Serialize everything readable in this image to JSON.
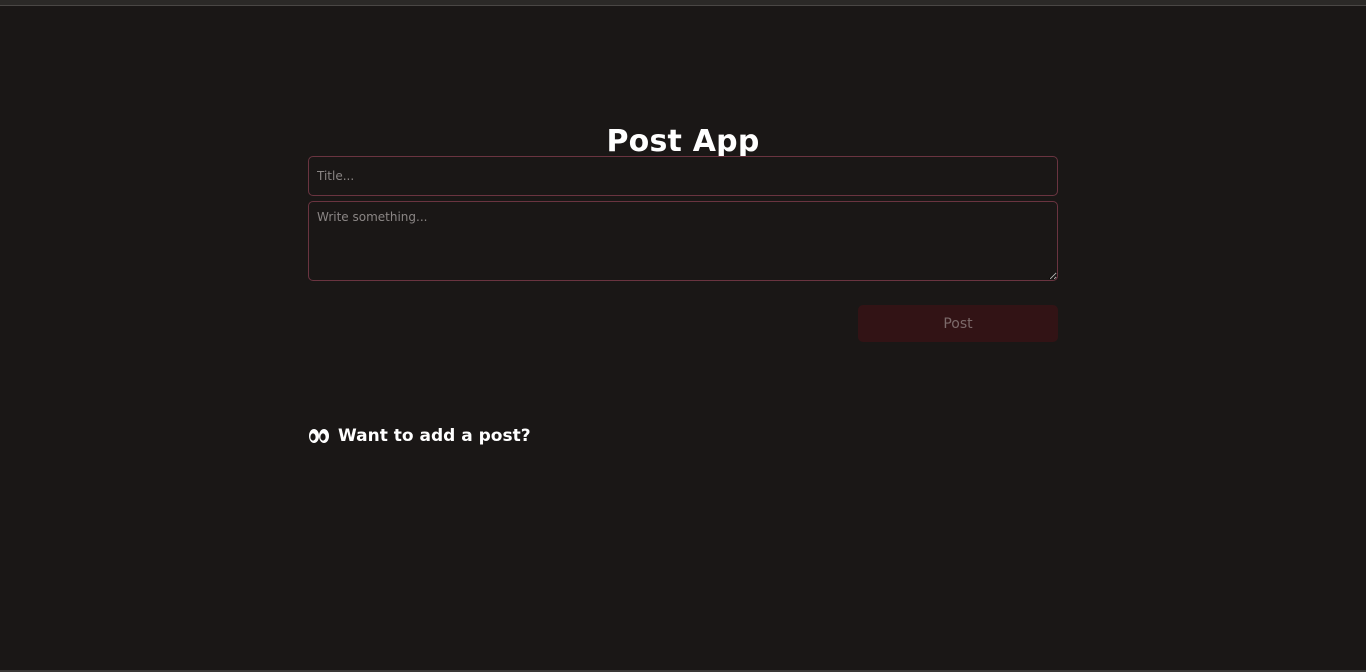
{
  "app": {
    "title": "Post App"
  },
  "form": {
    "title_placeholder": "Title...",
    "title_value": "",
    "body_placeholder": "Write something...",
    "body_value": "",
    "post_button_label": "Post"
  },
  "empty_state": {
    "icon": "eyes-icon",
    "message": "Want to add a post?"
  },
  "colors": {
    "background": "#1a1716",
    "input_border": "#6a3440",
    "button_background": "#321315",
    "button_text": "#7c6a6a",
    "text": "#ffffff"
  }
}
